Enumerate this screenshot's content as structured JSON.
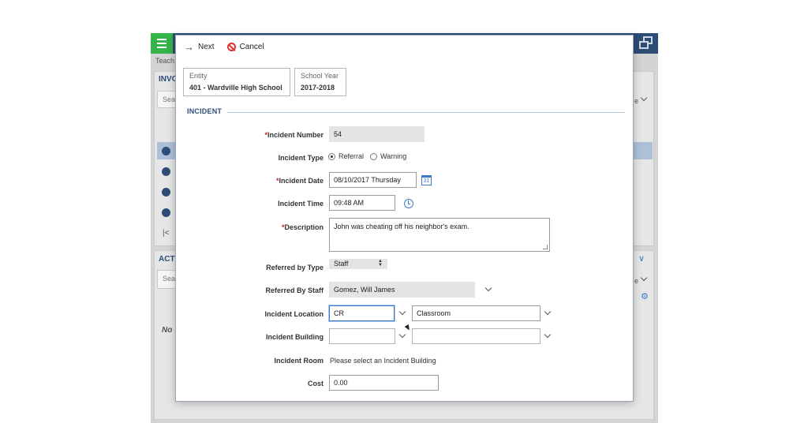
{
  "background_app": {
    "breadcrumb": "Teach",
    "section_1": "INVO",
    "section_1_search": "Sea",
    "section_2": "ACT",
    "section_2_search": "Sea",
    "no_text": "No",
    "right_e": "e"
  },
  "toolbar": {
    "next_label": "Next",
    "cancel_label": "Cancel"
  },
  "entity": {
    "label": "Entity",
    "value": "401 - Wardville High School"
  },
  "school_year": {
    "label": "School Year",
    "value": "2017-2018"
  },
  "section": {
    "title": "INCIDENT"
  },
  "form": {
    "incident_number": {
      "label": "Incident Number",
      "required_mark": "*",
      "value": "54"
    },
    "incident_type": {
      "label": "Incident Type",
      "options": [
        "Referral",
        "Warning"
      ],
      "selected": "Referral"
    },
    "incident_date": {
      "label": "Incident Date",
      "required_mark": "*",
      "value": "08/10/2017 Thursday",
      "icon_text": "31"
    },
    "incident_time": {
      "label": "Incident Time",
      "value": "09:48 AM"
    },
    "description": {
      "label": "Description",
      "required_mark": "*",
      "value": "John was cheating off his neighbor's exam."
    },
    "referred_by_type": {
      "label": "Referred by Type",
      "value": "Staff"
    },
    "referred_by_staff": {
      "label": "Referred By Staff",
      "value": "Gomez, Will James"
    },
    "incident_location": {
      "label": "Incident Location",
      "code": "CR",
      "name": "Classroom"
    },
    "incident_building": {
      "label": "Incident Building",
      "code": "",
      "name": ""
    },
    "incident_room": {
      "label": "Incident Room",
      "value": "Please select an Incident Building"
    },
    "cost": {
      "label": "Cost",
      "value": "0.00"
    }
  },
  "colors": {
    "brand_dark": "#2d4d77",
    "menu_green": "#35b44a",
    "required_red": "#c62020",
    "accent_blue": "#3c79c9"
  }
}
